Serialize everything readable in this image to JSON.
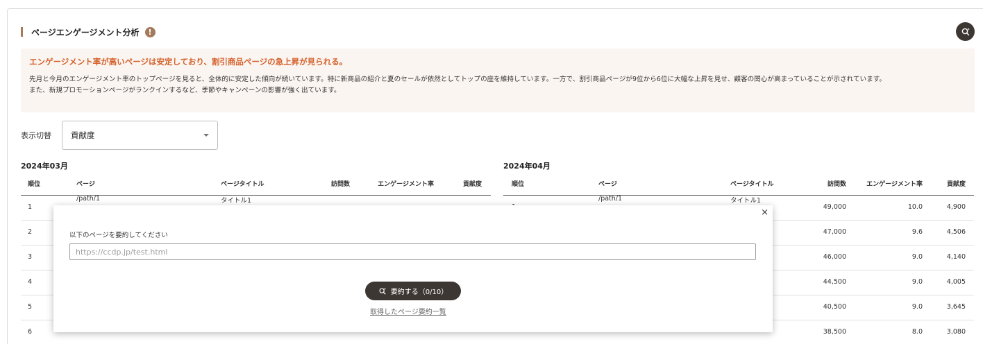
{
  "section": {
    "title": "ページエンゲージメント分析",
    "info_icon": "info-icon",
    "ai_icon": "ai-search-icon"
  },
  "insight": {
    "headline": "エンゲージメント率が高いページは安定しており、割引商品ページの急上昇が見られる。",
    "body_line1": "先月と今月のエンゲージメント率のトップページを見ると、全体的に安定した傾向が続いています。特に新商品の紹介と夏のセールが依然としてトップの座を維持しています。一方で、割引商品ページが9位から6位に大幅な上昇を見せ、顧客の関心が高まっていることが示されています。",
    "body_line2": "また、新規プロモーションページがランクインするなど、季節やキャンペーンの影響が強く出ています。"
  },
  "switcher": {
    "label": "表示切替",
    "selected": "貢献度"
  },
  "columns": {
    "rank": "順位",
    "page": "ページ",
    "page_title": "ページタイトル",
    "visits": "訪問数",
    "engagement": "エンゲージメント率",
    "contribution": "貢献度"
  },
  "march": {
    "month": "2024年03月",
    "rows": [
      {
        "rank": "1",
        "page": "/path/1",
        "title": "タイトル1"
      },
      {
        "rank": "2"
      },
      {
        "rank": "3"
      },
      {
        "rank": "4"
      },
      {
        "rank": "5"
      },
      {
        "rank": "6"
      }
    ]
  },
  "april": {
    "month": "2024年04月",
    "rows": [
      {
        "rank": "1",
        "page": "/path/1",
        "title": "タイトル1",
        "visits": "49,000",
        "engagement": "10.0",
        "contribution": "4,900"
      },
      {
        "visits": "47,000",
        "engagement": "9.6",
        "contribution": "4,506"
      },
      {
        "visits": "46,000",
        "engagement": "9.0",
        "contribution": "4,140"
      },
      {
        "visits": "44,500",
        "engagement": "9.0",
        "contribution": "4,005"
      },
      {
        "visits": "40,500",
        "engagement": "9.0",
        "contribution": "3,645"
      },
      {
        "visits": "38,500",
        "engagement": "8.0",
        "contribution": "3,080"
      }
    ]
  },
  "modal": {
    "label": "以下のページを要約してください",
    "placeholder": "https://ccdp.jp/test.html",
    "run_button": "要約する（0/10）",
    "history_link": "取得したページ要約一覧",
    "close": "×"
  }
}
